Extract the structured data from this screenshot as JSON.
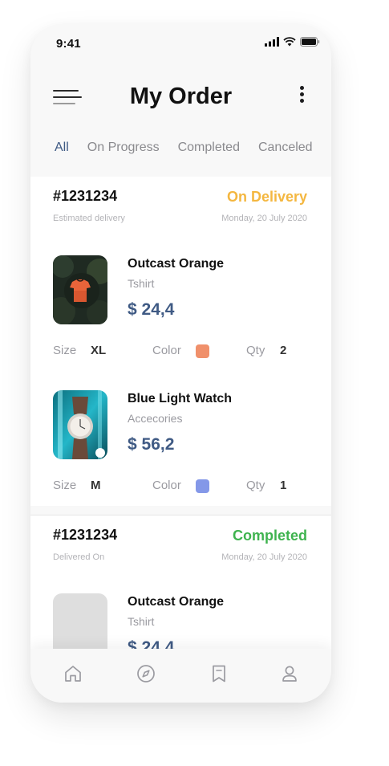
{
  "status_bar": {
    "time": "9:41"
  },
  "header": {
    "title": "My Order"
  },
  "tabs": [
    {
      "label": "All",
      "active": true
    },
    {
      "label": "On Progress",
      "active": false
    },
    {
      "label": "Completed",
      "active": false
    },
    {
      "label": "Canceled",
      "active": false
    }
  ],
  "orders": [
    {
      "id": "#1231234",
      "status": "On Delivery",
      "status_color": "#f4b740",
      "sub_label": "Estimated delivery",
      "date": "Monday, 20 July 2020",
      "items": [
        {
          "name": "Outcast Orange",
          "category": "Tshirt",
          "price": "$ 24,4",
          "size_label": "Size",
          "size": "XL",
          "color_label": "Color",
          "color": "#f0906b",
          "qty_label": "Qty",
          "qty": "2",
          "image": "orange-tshirt-photo"
        },
        {
          "name": "Blue Light Watch",
          "category": "Accecories",
          "price": "$ 56,2",
          "size_label": "Size",
          "size": "M",
          "color_label": "Color",
          "color": "#8498e8",
          "qty_label": "Qty",
          "qty": "1",
          "image": "watch-photo"
        }
      ]
    },
    {
      "id": "#1231234",
      "status": "Completed",
      "status_color": "#3fb34f",
      "sub_label": "Delivered On",
      "date": "Monday, 20 July 2020",
      "items": [
        {
          "name": "Outcast Orange",
          "category": "Tshirt",
          "price": "$ 24,4",
          "image": "placeholder"
        }
      ]
    }
  ],
  "bottom_nav": [
    {
      "icon": "home-icon"
    },
    {
      "icon": "compass-icon"
    },
    {
      "icon": "bookmark-icon"
    },
    {
      "icon": "profile-icon"
    }
  ],
  "colors": {
    "accent": "#3f5a84",
    "muted": "#9a9aa0"
  }
}
